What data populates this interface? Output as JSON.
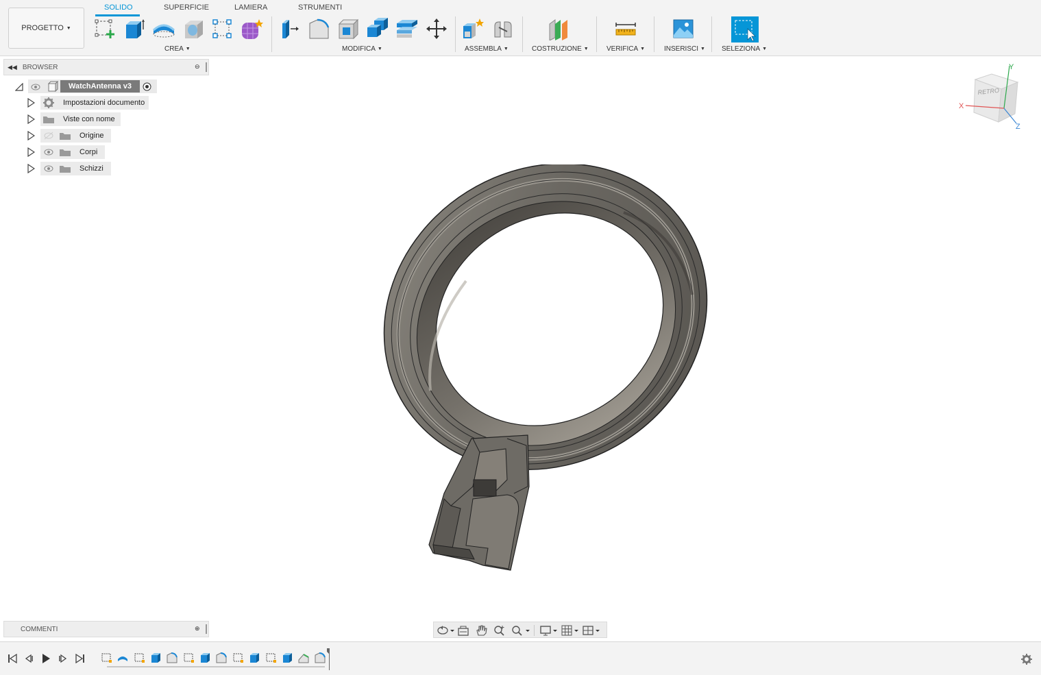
{
  "project": {
    "label": "PROGETTO"
  },
  "tabs": [
    {
      "label": "SOLIDO",
      "active": true
    },
    {
      "label": "SUPERFICIE",
      "active": false
    },
    {
      "label": "LAMIERA",
      "active": false
    },
    {
      "label": "STRUMENTI",
      "active": false
    }
  ],
  "groups": {
    "crea": "CREA",
    "modifica": "MODIFICA",
    "assembla": "ASSEMBLA",
    "costruzione": "COSTRUZIONE",
    "verifica": "VERIFICA",
    "inserisci": "INSERISCI",
    "seleziona": "SELEZIONA"
  },
  "browser": {
    "title": "BROWSER",
    "root": "WatchAntenna v3",
    "items": [
      {
        "label": "Impostazioni documento",
        "icon": "gear-icon"
      },
      {
        "label": "Viste con nome",
        "icon": "folder-icon"
      },
      {
        "label": "Origine",
        "icon": "folder-icon",
        "visible": false
      },
      {
        "label": "Corpi",
        "icon": "folder-icon",
        "visible": true
      },
      {
        "label": "Schizzi",
        "icon": "folder-icon",
        "visible": true
      }
    ]
  },
  "comments": {
    "title": "COMMENTI"
  },
  "viewcube": {
    "face": "RETRO",
    "axis_x": "X",
    "axis_y": "Y",
    "axis_z": "Z"
  },
  "colors": {
    "accent": "#0696d7",
    "model": "#6b6862",
    "background": "#ffffff"
  }
}
